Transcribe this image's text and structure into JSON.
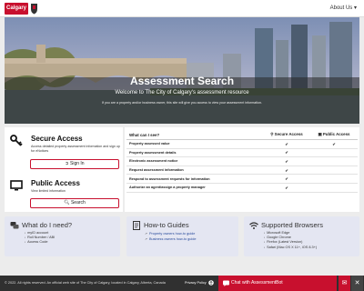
{
  "header": {
    "logo_text": "Calgary",
    "about_label": "About Us"
  },
  "hero": {
    "title": "Assessment Search",
    "subtitle": "Welcome to The City of Calgary's assessment resource",
    "description": "If you are a property and/or business owner, this site will give you access to view your assessment information."
  },
  "secure_access": {
    "title": "Secure Access",
    "description": "Access detailed property assessment information and sign up for eNotices",
    "button_label": "Sign In"
  },
  "public_access": {
    "title": "Public Access",
    "description": "View limited information",
    "button_label": "Search"
  },
  "comparison": {
    "col_question": "What can I see?",
    "col_secure": "Secure Access",
    "col_public": "Public Access",
    "rows": [
      {
        "label": "Property assessed value",
        "secure": "✔",
        "public": "✔"
      },
      {
        "label": "Property assessment details",
        "secure": "✔",
        "public": ""
      },
      {
        "label": "Electronic assessment notice",
        "secure": "✔",
        "public": ""
      },
      {
        "label": "Request assessment information",
        "secure": "✔",
        "public": ""
      },
      {
        "label": "Respond to assessment requests for information",
        "secure": "✔",
        "public": ""
      },
      {
        "label": "Authorize an agent/assign a property manager",
        "secure": "✔",
        "public": ""
      }
    ]
  },
  "cards": {
    "help": {
      "title": "What do I need?",
      "items": [
        "myID account",
        "Roll Number / ABI",
        "Access Code"
      ]
    },
    "guides": {
      "title": "How-to Guides",
      "links": [
        "Property owners how-to guide",
        "Business owners how-to guide"
      ]
    },
    "browsers": {
      "title": "Supported Browsers",
      "items": [
        "Microsoft Edge",
        "Google Chrome",
        "Firefox (Latest Version)",
        "Safari (Mac OS X 11+, iOS 8.3+)"
      ]
    }
  },
  "footer": {
    "copyright": "© 2022. All rights reserved. An official web site of The City of Calgary, located in Calgary, Alberta, Canada",
    "privacy_label": "Privacy Policy",
    "chat_label": "Chat with AssessmentBot"
  },
  "colors": {
    "brand_red": "#c8102e",
    "card_bg": "#e4e6f2",
    "footer_bg": "#303030"
  }
}
